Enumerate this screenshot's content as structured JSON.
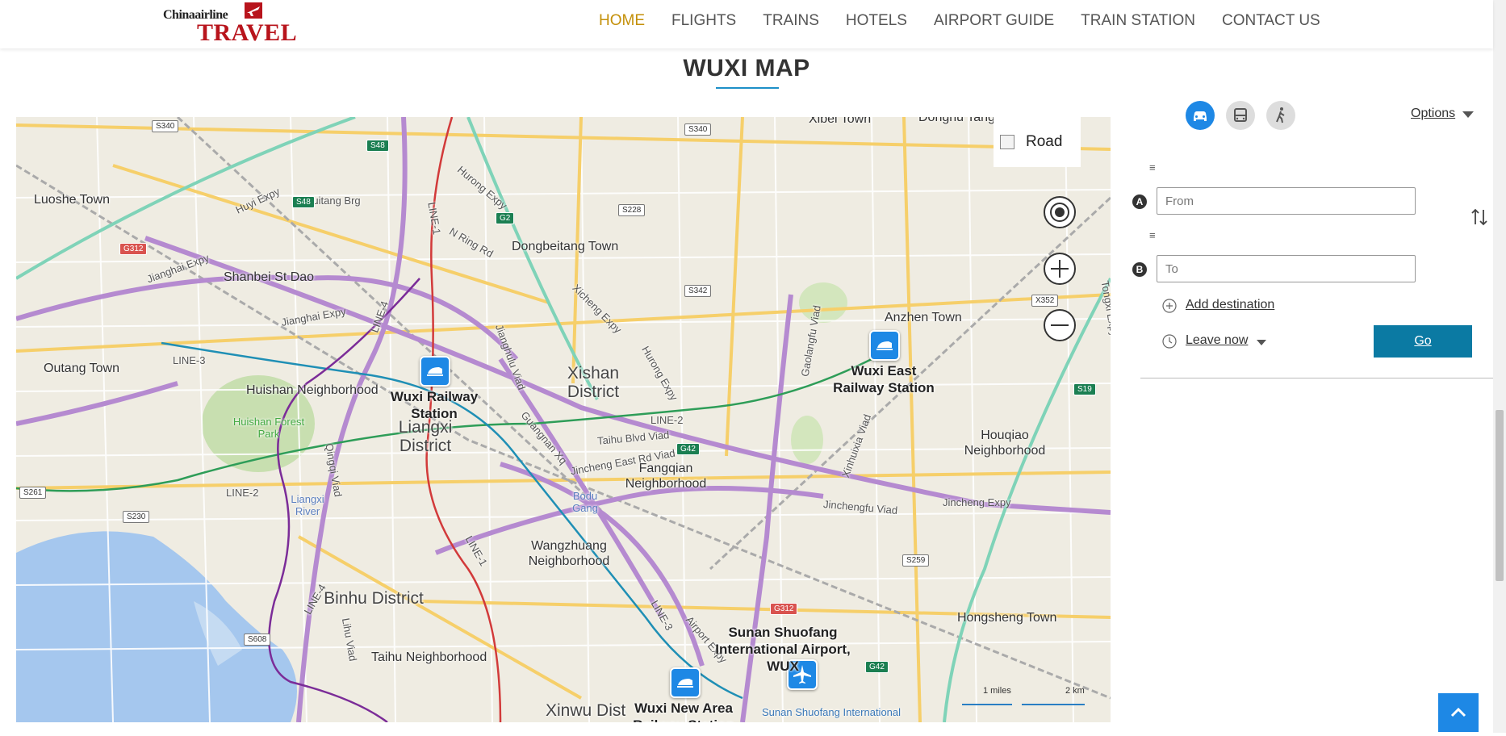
{
  "header": {
    "logo_small": "Chinaairline",
    "logo_big": "TRAVEL",
    "nav": [
      "HOME",
      "FLIGHTS",
      "TRAINS",
      "HOTELS",
      "AIRPORT GUIDE",
      "TRAIN STATION",
      "CONTACT US"
    ],
    "active_nav": "HOME"
  },
  "page_title": "WUXI MAP",
  "map": {
    "layer_toggle_label": "Road",
    "labels": {
      "xibei": "Xibei Town",
      "donghu": "Donghu Tang Town",
      "luoshe": "Luoshe Town",
      "dongbeitang": "Dongbeitang Town",
      "shanbei": "Shanbei St Dao",
      "anzhen": "Anzhen Town",
      "outang": "Outang Town",
      "huishan": "Huishan Neighborhood",
      "huishan_forest": "Huishan Forest Park",
      "xishan": "Xishan District",
      "liangxi": "Liangxi District",
      "liangxi_river": "Liangxi River",
      "houqiao": "Houqiao Neighborhood",
      "fangqian": "Fangqian Neighborhood",
      "bodu": "Bodu Gang",
      "wangzhuang": "Wangzhuang Neighborhood",
      "binhu": "Binhu District",
      "hongsheng": "Hongsheng Town",
      "taihu": "Taihu Neighborhood",
      "xinwu": "Xinwu Dist",
      "wuxi_station": "Wuxi Railway Station",
      "wuxi_east": "Wuxi East Railway Station",
      "airport": "Sunan Shuofang International Airport, WUX",
      "airport_small": "Sunan Shuofang International",
      "new_area": "Wuxi New Area Railway Station"
    },
    "roads": {
      "line1": "LINE-1",
      "line2": "LINE-2",
      "line3": "LINE-3",
      "line4": "LINE-4",
      "huyi": "Huyi Expy",
      "huitang": "Huitang Brg",
      "jianghai": "Jianghai Expy",
      "hurong": "Hurong Expy",
      "nring": "N Ring Rd",
      "xicheng": "Xicheng Expy",
      "gaolangfu": "Gaolangfu Viad",
      "taihublvd": "Taihu Blvd Viad",
      "jinchengeast": "Jincheng East Rd Viad",
      "jinchengfu": "Jinchengfu Viad",
      "jinchengexpy": "Jincheng Expy",
      "xinhuixia": "Xinhuixia Viad",
      "guangnan": "Guangnan Xq",
      "jianghulu": "Jianghulu Viad",
      "qingqi": "Qingqi Viad",
      "airport_expy": "Airport Expy",
      "tongxi": "Tongxi Expy",
      "lihu": "Lihu Viad"
    },
    "shields": {
      "s340a": "S340",
      "s48a": "S48",
      "s48b": "S48",
      "s340b": "S340",
      "g2": "G2",
      "s228": "S228",
      "g312a": "G312",
      "s342": "S342",
      "x352": "X352",
      "s19": "S19",
      "g42a": "G42",
      "s261": "S261",
      "s230": "S230",
      "s259": "S259",
      "g312b": "G312",
      "s608": "S608",
      "g42b": "G42"
    },
    "scale_miles": "1 miles",
    "scale_km": "2 km"
  },
  "directions": {
    "options_label": "Options",
    "from_placeholder": "From",
    "to_placeholder": "To",
    "badge_a": "A",
    "badge_b": "B",
    "add_destination": "Add destination",
    "leave_now": "Leave now",
    "go_label": "Go",
    "mode_active": "drive",
    "accent": "#1e88e5"
  }
}
